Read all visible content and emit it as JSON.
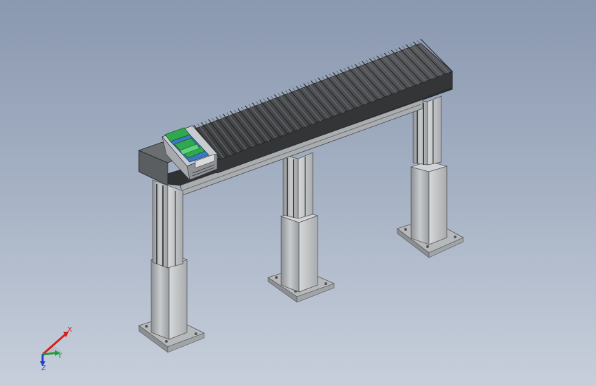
{
  "viewport": {
    "background_top": "#8a98b0",
    "background_bottom": "#c7cfdb"
  },
  "model": {
    "beam_color": "#3f4143",
    "bellows_color": "#4a4c4f",
    "column_color": "#b9bcbe",
    "carriage_accent": "#2fa84f",
    "carriage_blue": "#3a78c2"
  },
  "triad": {
    "x_label": "X",
    "y_label": "Y",
    "z_label": "Z",
    "x_color": "#d22020",
    "y_color": "#1fa03a",
    "z_color": "#2040d0"
  }
}
